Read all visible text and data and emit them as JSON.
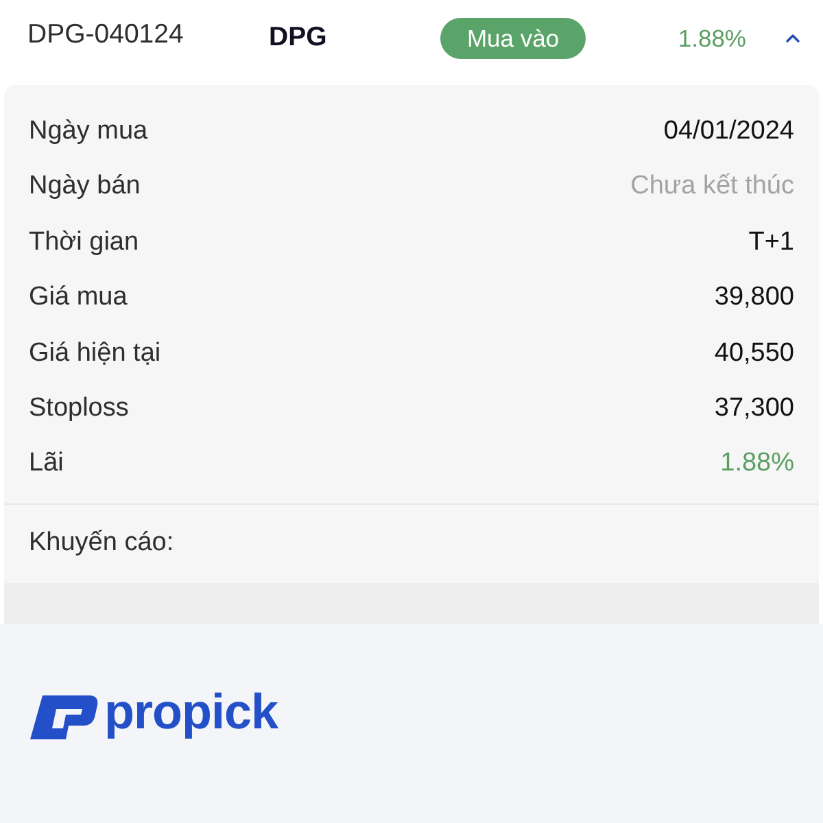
{
  "trade": {
    "code": "DPG-040124",
    "symbol": "DPG",
    "action": {
      "label": "Mua vào"
    },
    "change": {
      "text": "1.88%",
      "positive": true
    },
    "expanded": true
  },
  "details": [
    {
      "label": "Ngày mua",
      "value": "04/01/2024",
      "color": "#111111"
    },
    {
      "label": "Ngày bán",
      "value": "Chưa kết thúc",
      "color": "#a3a3a3"
    },
    {
      "label": "Thời gian",
      "value": "T+1",
      "color": "#111111"
    },
    {
      "label": "Giá mua",
      "value": "39,800",
      "color": "#111111"
    },
    {
      "label": "Giá hiện tại",
      "value": "40,550",
      "color": "#111111"
    },
    {
      "label": "Stoploss",
      "value": "37,300",
      "color": "#111111"
    },
    {
      "label": "Lãi",
      "value": "1.88%",
      "color": "#5a9e62"
    }
  ],
  "note": {
    "label": "Khuyến cáo:"
  },
  "footer": {
    "logo_text": "propick"
  }
}
